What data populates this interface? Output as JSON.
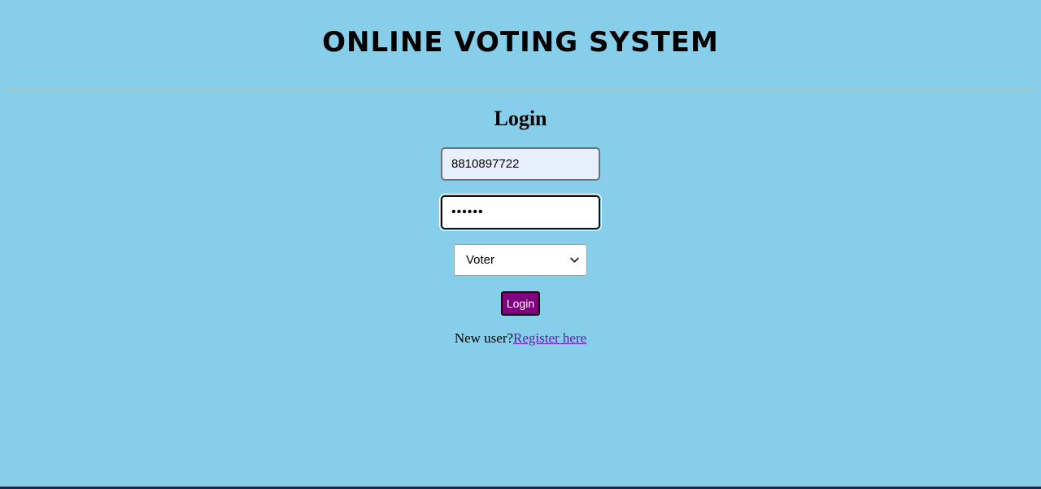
{
  "header": {
    "title": "ONLINE VOTING SYSTEM"
  },
  "login_form": {
    "heading": "Login",
    "mobile": {
      "value": "8810897722"
    },
    "password": {
      "masked_value": "••••••"
    },
    "role": {
      "selected": "Voter"
    },
    "submit_label": "Login",
    "register_prompt": "New user?",
    "register_link": "Register here"
  },
  "colors": {
    "background": "#87ceeb",
    "button": "#800080",
    "autofill_field": "#e8f0fe",
    "link": "#5a1fa8"
  },
  "icons": {
    "select_arrow": "chevron-down-icon"
  }
}
